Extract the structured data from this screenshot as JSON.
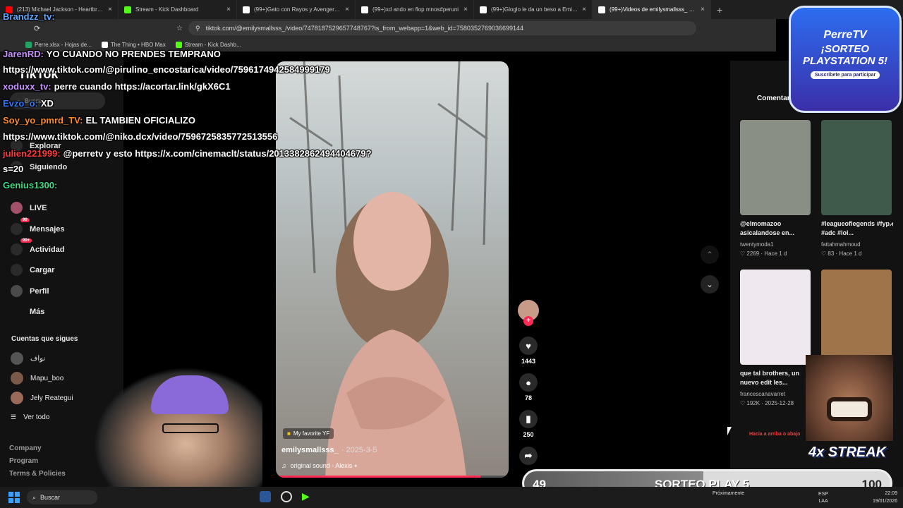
{
  "browser": {
    "tabs": [
      {
        "label": "(213) Michael Jackson - Heartbreak H",
        "color": "#ff0000"
      },
      {
        "label": "Stream - Kick Dashboard",
        "color": "#53fc18"
      },
      {
        "label": "(99+)Gato con Rayos y Avengers Ass",
        "color": "#ffffff"
      },
      {
        "label": "(99+)xd ando en flop mnos#peruni",
        "color": "#ffffff"
      },
      {
        "label": "(99+)Gloglo le da un beso a Emi #en",
        "color": "#ffffff"
      },
      {
        "label": "(99+)Videos de emilysmallsss_ (@",
        "color": "#ffffff"
      }
    ],
    "url": "tiktok.com/@emilysmallsss_/video/7478187529657748767?is_from_webapp=1&web_id=7580352769036699144",
    "bookmarks": [
      {
        "label": "Perre.xlsx - Hojas de...",
        "color": "#1fa463"
      },
      {
        "label": "The Thing • HBO Max",
        "color": "#ffffff"
      },
      {
        "label": "Stream - Kick Dashb...",
        "color": "#53fc18"
      }
    ]
  },
  "chat": [
    {
      "user": "Brandzz_tv:",
      "text": "",
      "color": "#5fa8ff"
    },
    {
      "user": "JarenRD:",
      "text": "YO CUANDO NO PRENDES TEMPRANO",
      "color": "#c792ff"
    },
    {
      "user": "",
      "text": "https://www.tiktok.com/@pirulino_encostarica/video/7596174942584999179",
      "color": "#ffffff"
    },
    {
      "user": "xoduxx_tv:",
      "text": "perre cuando https://acortar.link/gkX6C1",
      "color": "#c792ff"
    },
    {
      "user": "Evzo_o:",
      "text": "XD",
      "color": "#2f7bff"
    },
    {
      "user": "Soy_yo_pmrd_TV:",
      "text": "EL TAMBIEN OFICIALIZO",
      "color": "#ff8a2a"
    },
    {
      "user": "",
      "text": "https://www.tiktok.com/@niko.dcx/video/7596725835772513556",
      "color": "#ffffff"
    },
    {
      "user": "julien221999:",
      "text": "@perretv y esto https://x.com/cinemaclt/status/2013382862494404679?",
      "color": "#ff3a3a"
    },
    {
      "user": "",
      "text": "s=20",
      "color": "#ffffff"
    },
    {
      "user": "Genius1300:",
      "text": "",
      "color": "#3ddc84"
    }
  ],
  "sidebar": {
    "logo": "TikTok",
    "search_placeholder": "Buscar",
    "items": [
      {
        "label": "Explorar",
        "icon": "compass-icon"
      },
      {
        "label": "Siguiendo",
        "icon": "following-icon"
      },
      {
        "label": "LIVE",
        "icon": "live-icon"
      },
      {
        "label": "Mensajes",
        "icon": "messages-icon",
        "badge": "99"
      },
      {
        "label": "Actividad",
        "icon": "activity-icon",
        "badge": "99+"
      },
      {
        "label": "Cargar",
        "icon": "upload-icon"
      },
      {
        "label": "Perfil",
        "icon": "profile-icon"
      },
      {
        "label": "Más",
        "icon": "more-icon"
      }
    ],
    "following_title": "Cuentas que sigues",
    "following": [
      {
        "name": "نواف",
        "color": "#555555"
      },
      {
        "name": "Mapu_boo",
        "color": "#7a5a4a"
      },
      {
        "name": "Jely Reategui",
        "color": "#9a6a5a"
      }
    ],
    "see_all": "Ver todo",
    "footer": [
      "Company",
      "Program",
      "Terms & Policies"
    ]
  },
  "video": {
    "tag": "My favorite YF",
    "username": "emilysmallsss_",
    "date": "· 2025-3-5",
    "sound": "original sound - Alexis ⭑",
    "progress": 0.88
  },
  "actions": {
    "likes": "1443",
    "comments": "78",
    "saves": "250"
  },
  "right_panel": {
    "tab": "Comentarios",
    "videos": [
      {
        "caption": "@elmomazoo asicalandose en...",
        "author": "twentymoda1",
        "likes": "2269",
        "time": "Hace 1 d",
        "color": "#8a8f86"
      },
      {
        "caption": "#leagueoflegends #fyp⩘ #adc #lol...",
        "author": "fattahmahmoud",
        "likes": "83",
        "time": "Hace 1 d",
        "color": "#3f5a4a"
      },
      {
        "caption": "que tal brothers, un nuevo edit les...",
        "author": "francescanavarret",
        "likes": "192K",
        "time": "2025-12-28",
        "color": "#efe8ee"
      },
      {
        "caption": "",
        "author": "",
        "likes": "",
        "time": "",
        "color": "#a0744a"
      }
    ]
  },
  "overlays": {
    "logo_name": "PerreTV",
    "logo_title": "¡SORTEO PLAYSTATION 5!",
    "logo_sub": "Suscríbete para participar",
    "streak": "4x STREAK",
    "hint": "Hacia a arriba o abajo",
    "goal_left": "49",
    "goal_center": "SORTEO PLAY 5",
    "goal_right": "100",
    "goal_progress": 0.49
  },
  "taskbar": {
    "search": "Buscar",
    "lang": "ESP",
    "lang2": "LAA",
    "time": "22:09",
    "date": "19/01/2026",
    "weather": "Próximamente"
  }
}
